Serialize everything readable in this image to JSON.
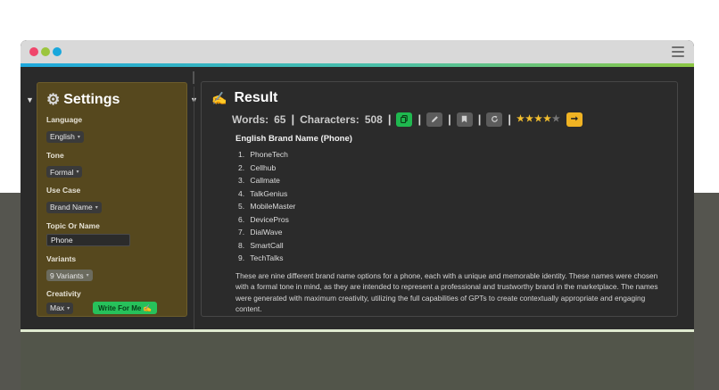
{
  "settings": {
    "title": "Settings",
    "gear_icon": "⚙",
    "fields": {
      "language": {
        "label": "Language",
        "value": "English"
      },
      "tone": {
        "label": "Tone",
        "value": "Formal"
      },
      "use_case": {
        "label": "Use Case",
        "value": "Brand Name"
      },
      "topic": {
        "label": "Topic Or Name",
        "value": "Phone"
      },
      "variants": {
        "label": "Variants",
        "value": "9 Variants"
      },
      "creativity": {
        "label": "Creativity",
        "value": "Max"
      }
    },
    "write_button": "Write For Me",
    "write_button_icon": "✍"
  },
  "result": {
    "title": "Result",
    "title_icon": "✍",
    "words_label": "Words:",
    "words_value": "65",
    "chars_label": "Characters:",
    "chars_value": "508",
    "rating": 4,
    "rating_max": 5,
    "heading": "English Brand Name (Phone)",
    "items": [
      {
        "num": "1.",
        "name": "PhoneTech"
      },
      {
        "num": "2.",
        "name": "Cellhub"
      },
      {
        "num": "3.",
        "name": "Callmate"
      },
      {
        "num": "4.",
        "name": "TalkGenius"
      },
      {
        "num": "5.",
        "name": "MobileMaster"
      },
      {
        "num": "6.",
        "name": "DevicePros"
      },
      {
        "num": "7.",
        "name": "DialWave"
      },
      {
        "num": "8.",
        "name": "SmartCall"
      },
      {
        "num": "9.",
        "name": "TechTalks"
      }
    ],
    "description": "These are nine different brand name options for a phone, each with a unique and memorable identity. These names were chosen with a formal tone in mind, as they are intended to represent a professional and trustworthy brand in the marketplace. The names were generated with maximum creativity, utilizing the full capabilities of GPTs to create contextually appropriate and engaging content."
  },
  "icons": {
    "copy": "copy-icon",
    "edit": "edit-icon",
    "bookmark": "bookmark-icon",
    "refresh": "refresh-icon",
    "next": "arrow-right-icon",
    "menu": "hamburger-menu-icon"
  },
  "colors": {
    "settings_panel": "#56481e",
    "accent_green": "#27c15b",
    "accent_yellow": "#f0b323",
    "window_dark": "#2a2a2a"
  }
}
